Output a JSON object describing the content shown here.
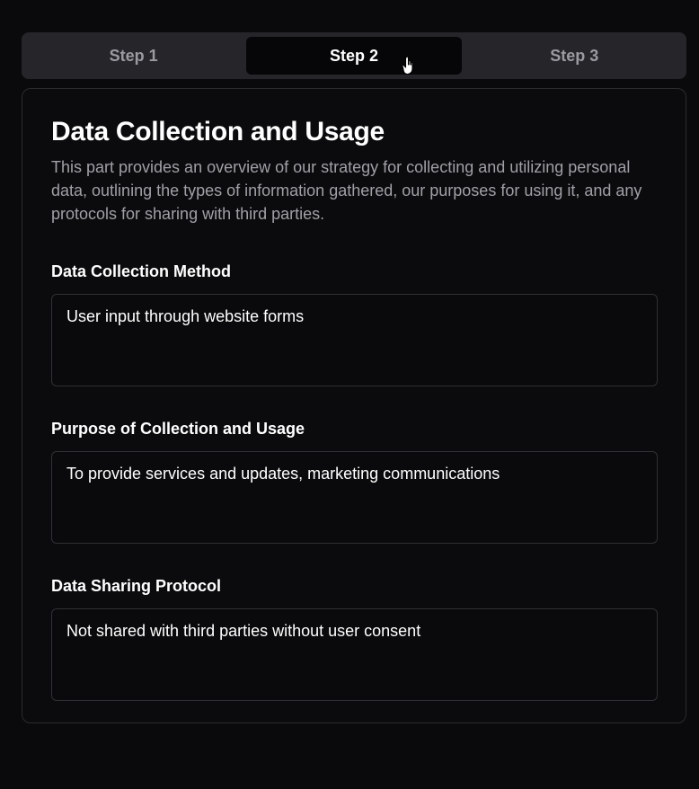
{
  "tabs": [
    {
      "label": "Step 1",
      "active": false
    },
    {
      "label": "Step 2",
      "active": true
    },
    {
      "label": "Step 3",
      "active": false
    }
  ],
  "section": {
    "title": "Data Collection and Usage",
    "description": "This part provides an overview of our strategy for collecting and utilizing personal data, outlining the types of information gathered, our purposes for using it, and any protocols for sharing with third parties."
  },
  "fields": [
    {
      "label": "Data Collection Method",
      "value": "User input through website forms"
    },
    {
      "label": "Purpose of Collection and Usage",
      "value": "To provide services and updates, marketing communications"
    },
    {
      "label": "Data Sharing Protocol",
      "value": "Not shared with third parties without user consent"
    }
  ],
  "icons": {
    "cursor": "hand-pointer-icon"
  },
  "colors": {
    "background": "#0a0a0c",
    "tab_bar": "#26262a",
    "active_tab": "#060608",
    "muted_text": "#a0a0a6"
  }
}
